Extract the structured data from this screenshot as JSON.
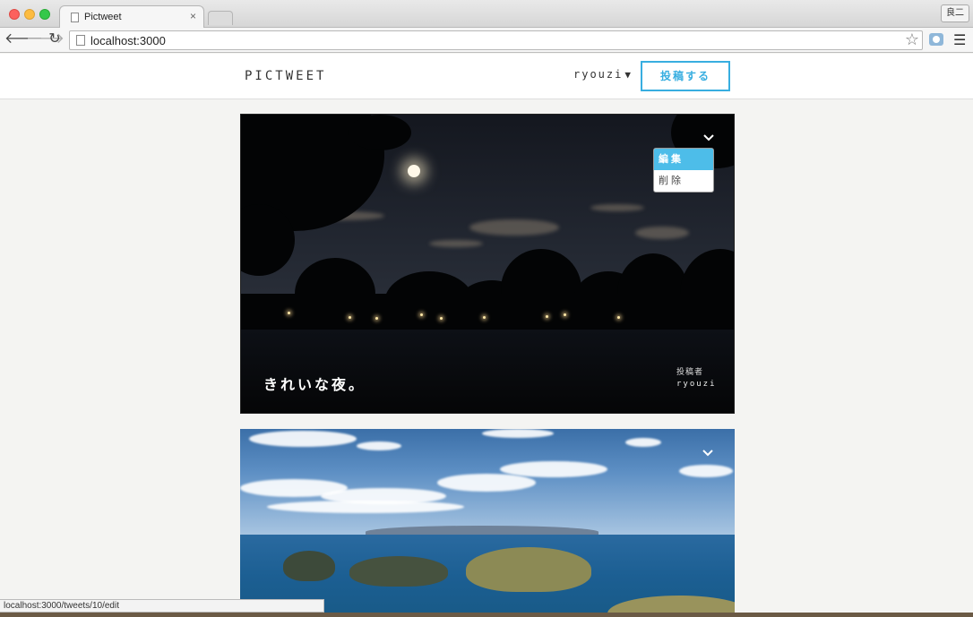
{
  "browser": {
    "tab_title": "Pictweet",
    "tab_close": "×",
    "url": "localhost:3000",
    "profile_name": "良二",
    "status_url": "localhost:3000/tweets/10/edit"
  },
  "header": {
    "logo": "PICTWEET",
    "user_name": "ryouzi",
    "user_caret": "▼",
    "post_button": "投稿する"
  },
  "posts": [
    {
      "caption": "きれいな夜。",
      "author_label": "投稿者",
      "author_name": "ryouzi",
      "menu": {
        "edit": "編集",
        "delete": "削除"
      }
    },
    {}
  ],
  "icons": [
    "back-arrow-icon",
    "forward-arrow-icon",
    "reload-icon",
    "page-icon",
    "star-icon",
    "camera-icon",
    "menu-icon",
    "chevron-down-icon"
  ]
}
